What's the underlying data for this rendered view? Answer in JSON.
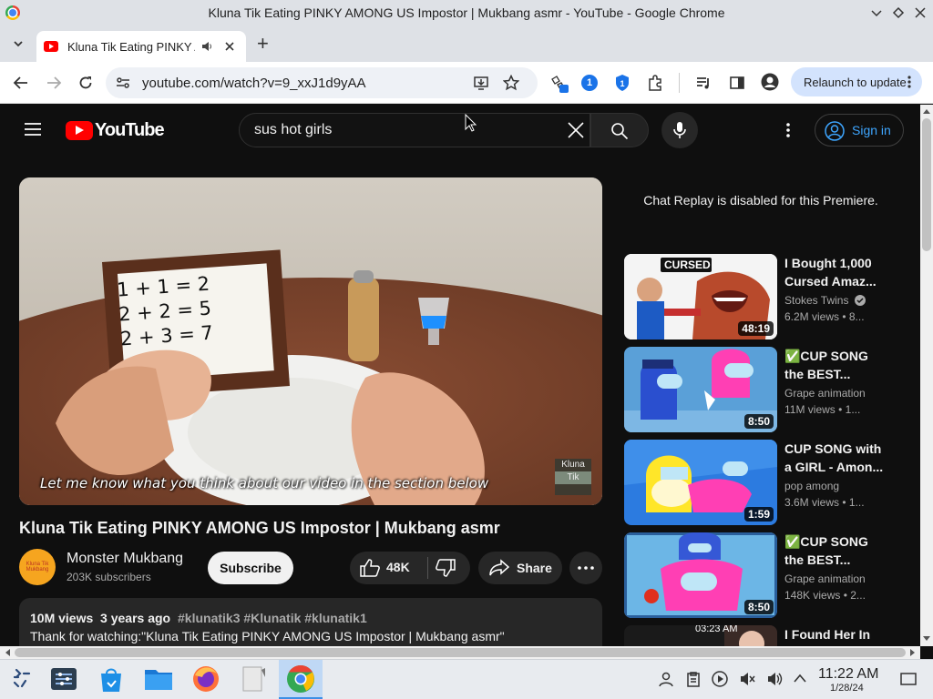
{
  "window": {
    "title": "Kluna Tik Eating PINKY AMONG US Impostor | Mukbang asmr - YouTube - Google Chrome"
  },
  "browser": {
    "tab_title": "Kluna Tik Eating PINKY AMONG US Impostor | Mukbang asmr",
    "new_tab": "+",
    "url": "youtube.com/watch?v=9_xxJ1d9yAA",
    "extension_badge": "1",
    "relaunch_label": "Relaunch to update"
  },
  "youtube": {
    "logo_text": "YouTube",
    "search_query": "sus hot girls",
    "signin_label": "Sign in",
    "video": {
      "caption": "Let me know what you think about our video in the section below",
      "watermark_top": "Kluna",
      "watermark_bottom": "Tik",
      "board_lines": [
        "1 + 1 = 2",
        "2 + 2 = 5",
        "2 + 3 = 7"
      ],
      "title": "Kluna Tik Eating PINKY AMONG US Impostor | Mukbang asmr"
    },
    "channel": {
      "name": "Monster Mukbang",
      "subscribers": "203K subscribers",
      "avatar_text": "Kluna Tik Mukbang"
    },
    "actions": {
      "subscribe": "Subscribe",
      "likes": "48K",
      "share": "Share"
    },
    "description": {
      "views": "10M views",
      "age": "3 years ago",
      "tags": "#klunatik3 #Klunatik #klunatik1",
      "text": "Thank for watching:\"Kluna Tik Eating PINKY AMONG US Impostor | Mukbang asmr\""
    },
    "chat_replay": "Chat Replay is disabled for this Premiere.",
    "recommendations": [
      {
        "title": "I Bought 1,000 Cursed Amaz...",
        "channel": "Stokes Twins",
        "meta": "6.2M views • 8...",
        "duration": "48:19",
        "thumb_label": "CURSED",
        "verified": true
      },
      {
        "title": "✅CUP SONG the BEST...",
        "channel": "Grape animation",
        "meta": "11M views • 1...",
        "duration": "8:50"
      },
      {
        "title": "CUP SONG with a GIRL - Amon...",
        "channel": "pop among",
        "meta": "3.6M views • 1...",
        "duration": "1:59"
      },
      {
        "title": "✅CUP SONG the BEST...",
        "channel": "Grape animation",
        "meta": "148K views • 2...",
        "duration": "8:50"
      },
      {
        "title": "I Found Her In",
        "channel": "",
        "meta": "",
        "duration": "03:23 AM"
      }
    ]
  },
  "taskbar": {
    "time": "11:22 AM",
    "date": "1/28/24"
  },
  "colors": {
    "yt_red": "#ff0000",
    "link_blue": "#3ea6ff",
    "relaunch_bg": "#d3e3fd"
  }
}
